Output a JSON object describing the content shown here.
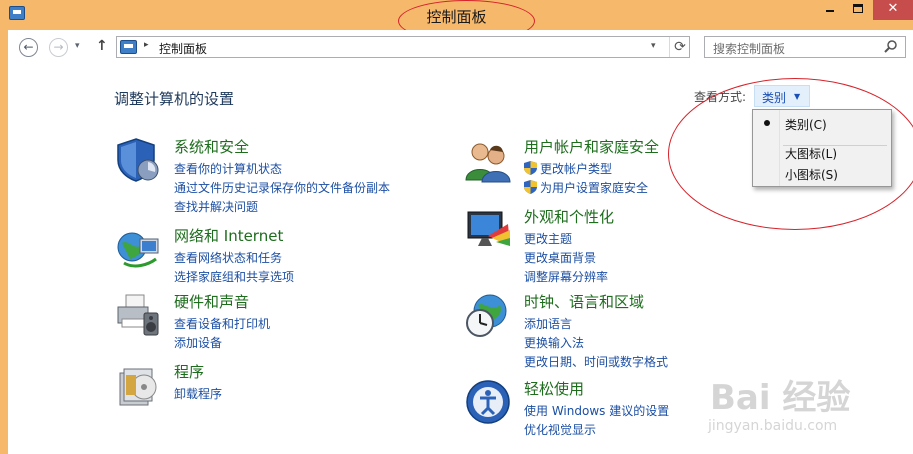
{
  "window": {
    "title": "控制面板",
    "minimize_label": "",
    "close_label": "✕"
  },
  "nav": {
    "back_glyph": "←",
    "forward_glyph": "→",
    "recent_glyph": "▾",
    "up_glyph": "↑",
    "breadcrumb": "控制面板",
    "breadcrumb_sep": "▸",
    "address_drop_glyph": "▾",
    "refresh_glyph": "⟳",
    "search_placeholder": "搜索控制面板"
  },
  "main": {
    "heading": "调整计算机的设置",
    "view_by_label": "查看方式:",
    "view_by_value": "类别",
    "view_by_caret": "▼"
  },
  "view_menu": {
    "items": [
      {
        "label": "类别(C)",
        "selected": true
      },
      {
        "label": "大图标(L)",
        "selected": false
      },
      {
        "label": "小图标(S)",
        "selected": false
      }
    ]
  },
  "categories": [
    {
      "title": "系统和安全",
      "icon": "shield-icon",
      "links": [
        "查看你的计算机状态",
        "通过文件历史记录保存你的文件备份副本",
        "查找并解决问题"
      ]
    },
    {
      "title": "网络和 Internet",
      "icon": "globe-network-icon",
      "links": [
        "查看网络状态和任务",
        "选择家庭组和共享选项"
      ]
    },
    {
      "title": "硬件和声音",
      "icon": "printer-speaker-icon",
      "links": [
        "查看设备和打印机",
        "添加设备"
      ]
    },
    {
      "title": "程序",
      "icon": "programs-icon",
      "links": [
        "卸载程序"
      ]
    },
    {
      "title": "用户帐户和家庭安全",
      "icon": "users-icon",
      "links": [
        "更改帐户类型",
        "为用户设置家庭安全"
      ]
    },
    {
      "title": "外观和个性化",
      "icon": "monitor-palette-icon",
      "links": [
        "更改主题",
        "更改桌面背景",
        "调整屏幕分辨率"
      ]
    },
    {
      "title": "时钟、语言和区域",
      "icon": "clock-globe-icon",
      "links": [
        "添加语言",
        "更换输入法",
        "更改日期、时间或数字格式"
      ]
    },
    {
      "title": "轻松使用",
      "icon": "ease-of-access-icon",
      "links": [
        "使用 Windows 建议的设置",
        "优化视觉显示"
      ]
    }
  ],
  "watermark": {
    "text": "Bai 经验",
    "sub": "jingyan.baidu.com"
  },
  "colors": {
    "frame": "#f6b86b",
    "category_title": "#1d6d1d",
    "link": "#1c4fa3",
    "annotation": "#d5232b"
  }
}
